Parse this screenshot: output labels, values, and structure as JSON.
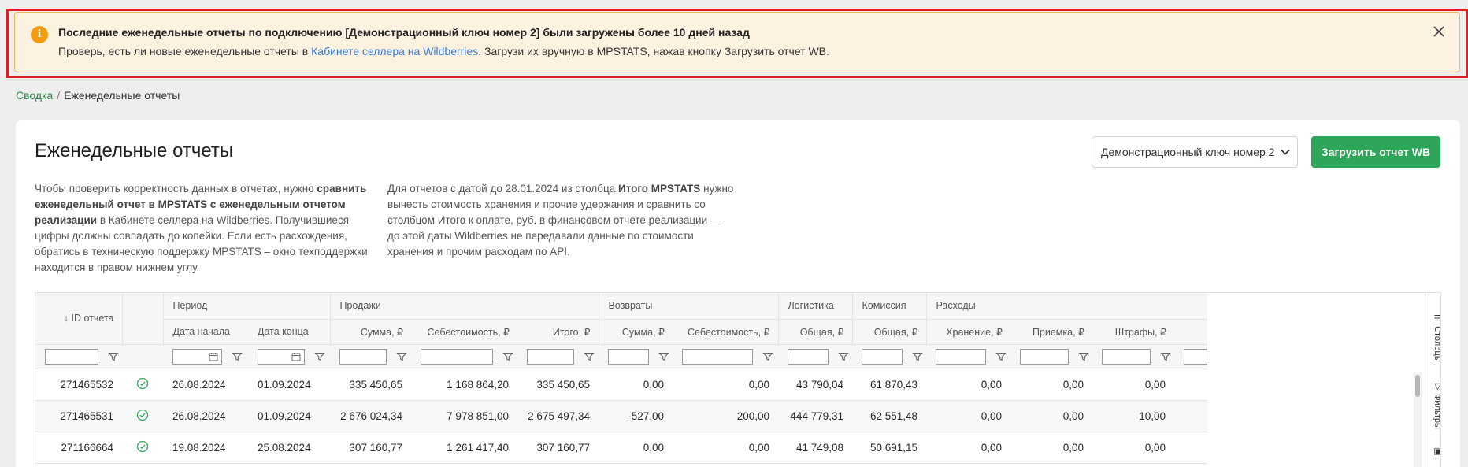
{
  "alert": {
    "title": "Последние еженедельные отчеты по подключению [Демонстрационный ключ номер 2] были загружены более 10 дней назад",
    "body_prefix": "Проверь, есть ли новые еженедельные отчеты в ",
    "body_link": "Кабинете селлера на Wildberries",
    "body_suffix": ". Загрузи их вручную в MPSTATS, нажав кнопку Загрузить отчет WB.",
    "icon": "info-icon",
    "close_icon": "close-icon"
  },
  "breadcrumb": {
    "parent": "Сводка",
    "separator": "/",
    "current": "Еженедельные отчеты"
  },
  "page": {
    "title": "Еженедельные отчеты",
    "key_select_value": "Демонстрационный ключ номер 2",
    "upload_button": "Загрузить отчет WB"
  },
  "description": {
    "left": {
      "p1": "Чтобы проверить корректность данных в отчетах, нужно ",
      "b1": "сравнить еженедельный отчет в MPSTATS с еженедельным отчетом реализации",
      "p2": " в Кабинете селлера на Wildberries. Получившиеся цифры должны совпадать до копейки. Если есть расхождения, обратись в техническую поддержку MPSTATS – окно техподдержки находится в правом нижнем углу."
    },
    "right": {
      "p1": "Для отчетов с датой до 28.01.2024 из столбца ",
      "b1": "Итого MPSTATS",
      "p2": " нужно вычесть стоимость хранения и прочие удержания и сравнить со столбцом Итого к оплате, руб. в финансовом отчете реализации — до этой даты Wildberries не передавали данные по стоимости хранения и прочим расходам по API."
    }
  },
  "table": {
    "groups": {
      "id": "↓ ID отчета",
      "period": "Период",
      "sales": "Продажи",
      "returns": "Возвраты",
      "logistics": "Логистика",
      "commission": "Комиссия",
      "expenses": "Расходы"
    },
    "columns": {
      "start": "Дата начала",
      "end": "Дата конца",
      "sales_sum": "Сумма, ₽",
      "sales_cost": "Себестоимость, ₽",
      "sales_total": "Итого, ₽",
      "ret_sum": "Сумма, ₽",
      "ret_cost": "Себестоимость, ₽",
      "log_total": "Общая, ₽",
      "com_total": "Общая, ₽",
      "storage": "Хранение, ₽",
      "acceptance": "Приемка, ₽",
      "fines": "Штрафы, ₽"
    },
    "rows": [
      {
        "id": "271465532",
        "start": "26.08.2024",
        "end": "01.09.2024",
        "sales_sum": "335 450,65",
        "sales_cost": "1 168 864,20",
        "sales_total": "335 450,65",
        "ret_sum": "0,00",
        "ret_cost": "0,00",
        "log": "43 790,04",
        "com": "61 870,43",
        "storage": "0,00",
        "acceptance": "0,00",
        "fines": "0,00"
      },
      {
        "id": "271465531",
        "start": "26.08.2024",
        "end": "01.09.2024",
        "sales_sum": "2 676 024,34",
        "sales_cost": "7 978 851,00",
        "sales_total": "2 675 497,34",
        "ret_sum": "-527,00",
        "ret_cost": "200,00",
        "log": "444 779,31",
        "com": "62 551,48",
        "storage": "0,00",
        "acceptance": "0,00",
        "fines": "10,00"
      },
      {
        "id": "271166664",
        "start": "19.08.2024",
        "end": "25.08.2024",
        "sales_sum": "307 160,77",
        "sales_cost": "1 261 417,40",
        "sales_total": "307 160,77",
        "ret_sum": "0,00",
        "ret_cost": "0,00",
        "log": "41 749,08",
        "com": "50 691,15",
        "storage": "0,00",
        "acceptance": "0,00",
        "fines": "0,00"
      }
    ],
    "side_tabs": {
      "columns": "Столбцы",
      "filters": "Фильтры"
    }
  },
  "colors": {
    "accent_green": "#2ea65a",
    "link_blue": "#2f7de1",
    "alert_bg": "#fdf1e0",
    "alert_icon": "#f39c12",
    "highlight_border": "#e02020"
  }
}
